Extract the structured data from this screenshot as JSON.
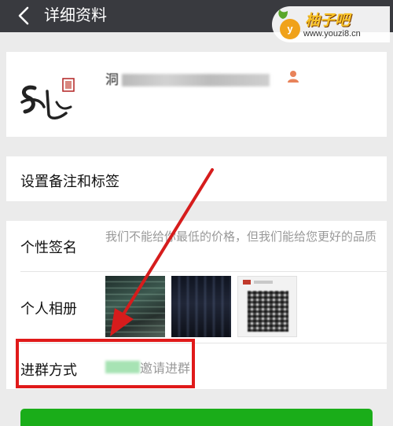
{
  "header": {
    "back_icon": "chevron-left-icon",
    "title": "详细资料"
  },
  "watermark": {
    "badge_letter": "y",
    "brand": "柚子吧",
    "url": "www.youzi8.cn"
  },
  "profile": {
    "nickname_prefix": "洞",
    "contact_icon": "person-icon"
  },
  "remark": {
    "label": "设置备注和标签"
  },
  "signature": {
    "label": "个性签名",
    "text": "我们不能给你最低的价格，但我们能给您更好的品质"
  },
  "album": {
    "label": "个人相册",
    "photo_count": 3
  },
  "join_method": {
    "label": "进群方式",
    "text": "邀请进群"
  },
  "colors": {
    "topbar": "#393a3f",
    "highlight": "#e01a1a",
    "button": "#1aad19"
  }
}
